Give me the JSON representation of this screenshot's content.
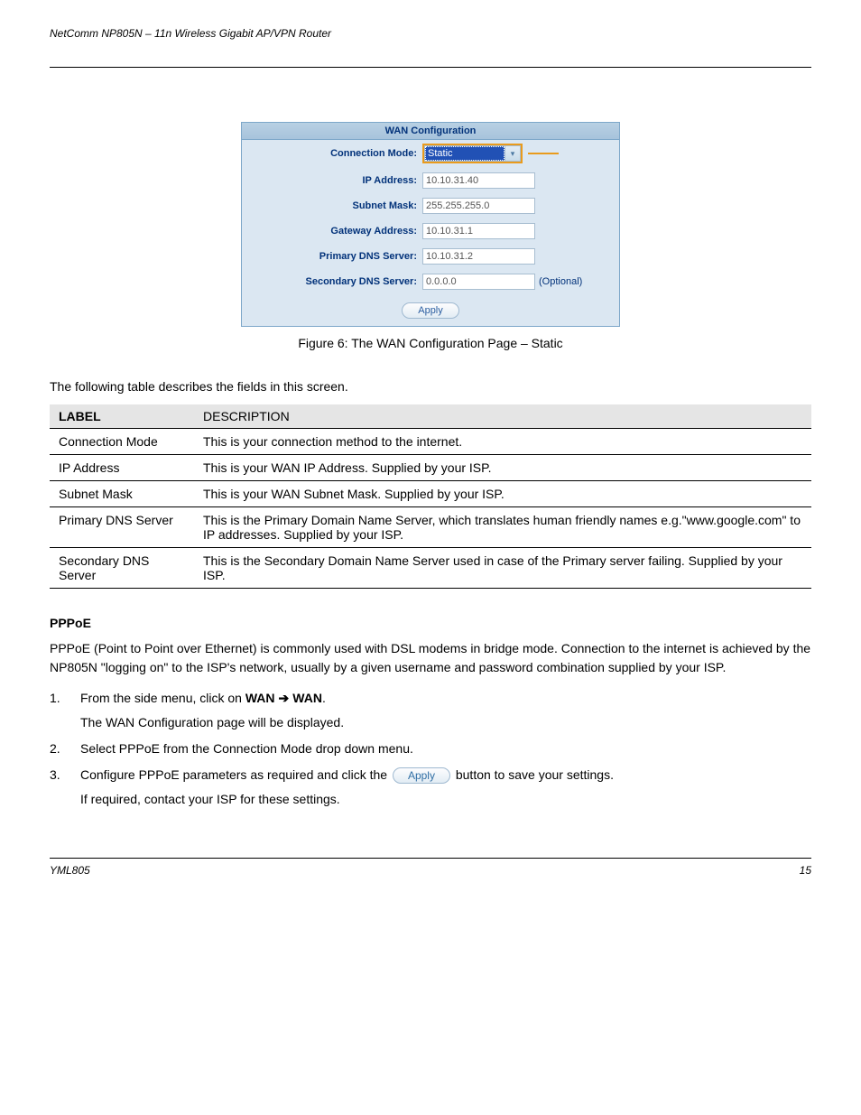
{
  "header_left": "NetComm NP805N – 11n Wireless Gigabit AP/VPN Router",
  "figure": {
    "panel_title": "WAN Configuration",
    "rows": {
      "conn_mode_label": "Connection Mode:",
      "conn_mode_value": "Static",
      "ip_label": "IP Address:",
      "ip_value": "10.10.31.40",
      "subnet_label": "Subnet Mask:",
      "subnet_value": "255.255.255.0",
      "gateway_label": "Gateway Address:",
      "gateway_value": "10.10.31.1",
      "pdns_label": "Primary DNS Server:",
      "pdns_value": "10.10.31.2",
      "sdns_label": "Secondary DNS Server:",
      "sdns_value": "0.0.0.0",
      "sdns_opt": "(Optional)"
    },
    "apply": "Apply",
    "caption": "Figure 6: The WAN Configuration Page – Static"
  },
  "para_desc": "The following table describes the fields in this screen.",
  "table": {
    "head_label": "LABEL",
    "head_desc": "DESCRIPTION",
    "rows": [
      {
        "label": "Connection Mode",
        "desc": "This is your connection method to the internet."
      },
      {
        "label": "IP Address",
        "desc": "This is your WAN IP Address. Supplied by your ISP."
      },
      {
        "label": "Subnet Mask",
        "desc": "This is your WAN Subnet Mask. Supplied by your ISP."
      },
      {
        "label": "Primary DNS Server",
        "desc": "This is the Primary Domain Name Server, which translates human friendly names e.g.\"www.google.com\" to IP addresses. Supplied by your ISP."
      },
      {
        "label": "Secondary DNS Server",
        "desc": "This is the Secondary Domain Name Server used in case of the Primary server failing. Supplied by your ISP."
      }
    ]
  },
  "subhead": "PPPoE",
  "pppoe_para": "PPPoE (Point to Point over Ethernet) is commonly used with DSL modems in bridge mode. Connection to the internet is achieved by the NP805N \"logging on\" to the ISP's network, usually by a given username and password combination supplied by your ISP.",
  "steps": [
    {
      "num": "1.",
      "lines": [
        "From the side menu, click on WAN ",
        " WAN.",
        "The WAN Configuration page will be displayed."
      ],
      "arrow_after_first": true
    },
    {
      "num": "2.",
      "lines": [
        "Select PPPoE from the Connection Mode drop down menu."
      ],
      "arrow_after_first": false
    },
    {
      "num": "3.",
      "lines": [
        "Configure PPPoE parameters as required and click the ",
        " button to save your settings.",
        "If required, contact your ISP for these settings."
      ],
      "arrow_after_first": false,
      "has_apply_btn": true,
      "apply_label": "Apply"
    }
  ],
  "footer_left": "YML805",
  "footer_right": "15"
}
